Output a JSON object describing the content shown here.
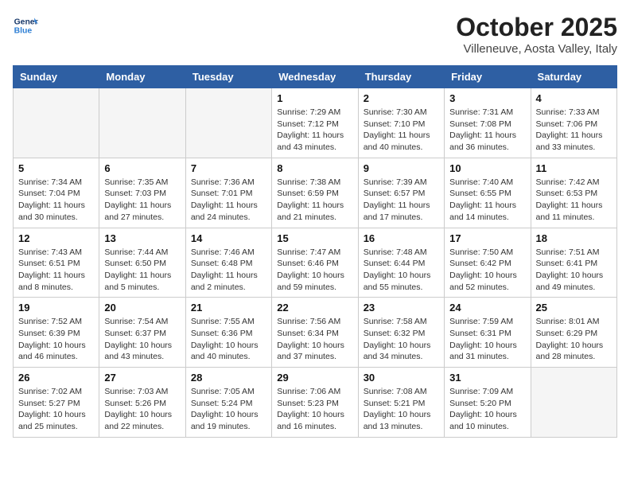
{
  "header": {
    "logo_line1": "General",
    "logo_line2": "Blue",
    "title": "October 2025",
    "subtitle": "Villeneuve, Aosta Valley, Italy"
  },
  "weekdays": [
    "Sunday",
    "Monday",
    "Tuesday",
    "Wednesday",
    "Thursday",
    "Friday",
    "Saturday"
  ],
  "weeks": [
    [
      {
        "date": "",
        "sunrise": "",
        "sunset": "",
        "daylight": ""
      },
      {
        "date": "",
        "sunrise": "",
        "sunset": "",
        "daylight": ""
      },
      {
        "date": "",
        "sunrise": "",
        "sunset": "",
        "daylight": ""
      },
      {
        "date": "1",
        "sunrise": "Sunrise: 7:29 AM",
        "sunset": "Sunset: 7:12 PM",
        "daylight": "Daylight: 11 hours and 43 minutes."
      },
      {
        "date": "2",
        "sunrise": "Sunrise: 7:30 AM",
        "sunset": "Sunset: 7:10 PM",
        "daylight": "Daylight: 11 hours and 40 minutes."
      },
      {
        "date": "3",
        "sunrise": "Sunrise: 7:31 AM",
        "sunset": "Sunset: 7:08 PM",
        "daylight": "Daylight: 11 hours and 36 minutes."
      },
      {
        "date": "4",
        "sunrise": "Sunrise: 7:33 AM",
        "sunset": "Sunset: 7:06 PM",
        "daylight": "Daylight: 11 hours and 33 minutes."
      }
    ],
    [
      {
        "date": "5",
        "sunrise": "Sunrise: 7:34 AM",
        "sunset": "Sunset: 7:04 PM",
        "daylight": "Daylight: 11 hours and 30 minutes."
      },
      {
        "date": "6",
        "sunrise": "Sunrise: 7:35 AM",
        "sunset": "Sunset: 7:03 PM",
        "daylight": "Daylight: 11 hours and 27 minutes."
      },
      {
        "date": "7",
        "sunrise": "Sunrise: 7:36 AM",
        "sunset": "Sunset: 7:01 PM",
        "daylight": "Daylight: 11 hours and 24 minutes."
      },
      {
        "date": "8",
        "sunrise": "Sunrise: 7:38 AM",
        "sunset": "Sunset: 6:59 PM",
        "daylight": "Daylight: 11 hours and 21 minutes."
      },
      {
        "date": "9",
        "sunrise": "Sunrise: 7:39 AM",
        "sunset": "Sunset: 6:57 PM",
        "daylight": "Daylight: 11 hours and 17 minutes."
      },
      {
        "date": "10",
        "sunrise": "Sunrise: 7:40 AM",
        "sunset": "Sunset: 6:55 PM",
        "daylight": "Daylight: 11 hours and 14 minutes."
      },
      {
        "date": "11",
        "sunrise": "Sunrise: 7:42 AM",
        "sunset": "Sunset: 6:53 PM",
        "daylight": "Daylight: 11 hours and 11 minutes."
      }
    ],
    [
      {
        "date": "12",
        "sunrise": "Sunrise: 7:43 AM",
        "sunset": "Sunset: 6:51 PM",
        "daylight": "Daylight: 11 hours and 8 minutes."
      },
      {
        "date": "13",
        "sunrise": "Sunrise: 7:44 AM",
        "sunset": "Sunset: 6:50 PM",
        "daylight": "Daylight: 11 hours and 5 minutes."
      },
      {
        "date": "14",
        "sunrise": "Sunrise: 7:46 AM",
        "sunset": "Sunset: 6:48 PM",
        "daylight": "Daylight: 11 hours and 2 minutes."
      },
      {
        "date": "15",
        "sunrise": "Sunrise: 7:47 AM",
        "sunset": "Sunset: 6:46 PM",
        "daylight": "Daylight: 10 hours and 59 minutes."
      },
      {
        "date": "16",
        "sunrise": "Sunrise: 7:48 AM",
        "sunset": "Sunset: 6:44 PM",
        "daylight": "Daylight: 10 hours and 55 minutes."
      },
      {
        "date": "17",
        "sunrise": "Sunrise: 7:50 AM",
        "sunset": "Sunset: 6:42 PM",
        "daylight": "Daylight: 10 hours and 52 minutes."
      },
      {
        "date": "18",
        "sunrise": "Sunrise: 7:51 AM",
        "sunset": "Sunset: 6:41 PM",
        "daylight": "Daylight: 10 hours and 49 minutes."
      }
    ],
    [
      {
        "date": "19",
        "sunrise": "Sunrise: 7:52 AM",
        "sunset": "Sunset: 6:39 PM",
        "daylight": "Daylight: 10 hours and 46 minutes."
      },
      {
        "date": "20",
        "sunrise": "Sunrise: 7:54 AM",
        "sunset": "Sunset: 6:37 PM",
        "daylight": "Daylight: 10 hours and 43 minutes."
      },
      {
        "date": "21",
        "sunrise": "Sunrise: 7:55 AM",
        "sunset": "Sunset: 6:36 PM",
        "daylight": "Daylight: 10 hours and 40 minutes."
      },
      {
        "date": "22",
        "sunrise": "Sunrise: 7:56 AM",
        "sunset": "Sunset: 6:34 PM",
        "daylight": "Daylight: 10 hours and 37 minutes."
      },
      {
        "date": "23",
        "sunrise": "Sunrise: 7:58 AM",
        "sunset": "Sunset: 6:32 PM",
        "daylight": "Daylight: 10 hours and 34 minutes."
      },
      {
        "date": "24",
        "sunrise": "Sunrise: 7:59 AM",
        "sunset": "Sunset: 6:31 PM",
        "daylight": "Daylight: 10 hours and 31 minutes."
      },
      {
        "date": "25",
        "sunrise": "Sunrise: 8:01 AM",
        "sunset": "Sunset: 6:29 PM",
        "daylight": "Daylight: 10 hours and 28 minutes."
      }
    ],
    [
      {
        "date": "26",
        "sunrise": "Sunrise: 7:02 AM",
        "sunset": "Sunset: 5:27 PM",
        "daylight": "Daylight: 10 hours and 25 minutes."
      },
      {
        "date": "27",
        "sunrise": "Sunrise: 7:03 AM",
        "sunset": "Sunset: 5:26 PM",
        "daylight": "Daylight: 10 hours and 22 minutes."
      },
      {
        "date": "28",
        "sunrise": "Sunrise: 7:05 AM",
        "sunset": "Sunset: 5:24 PM",
        "daylight": "Daylight: 10 hours and 19 minutes."
      },
      {
        "date": "29",
        "sunrise": "Sunrise: 7:06 AM",
        "sunset": "Sunset: 5:23 PM",
        "daylight": "Daylight: 10 hours and 16 minutes."
      },
      {
        "date": "30",
        "sunrise": "Sunrise: 7:08 AM",
        "sunset": "Sunset: 5:21 PM",
        "daylight": "Daylight: 10 hours and 13 minutes."
      },
      {
        "date": "31",
        "sunrise": "Sunrise: 7:09 AM",
        "sunset": "Sunset: 5:20 PM",
        "daylight": "Daylight: 10 hours and 10 minutes."
      },
      {
        "date": "",
        "sunrise": "",
        "sunset": "",
        "daylight": ""
      }
    ]
  ]
}
